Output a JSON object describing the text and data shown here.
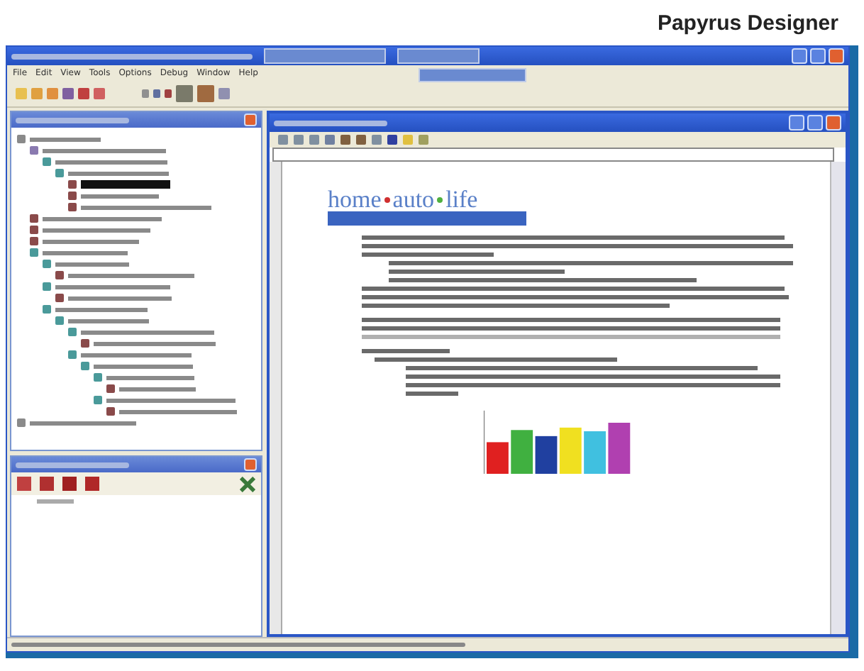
{
  "header": {
    "title": "Papyrus Designer"
  },
  "menu": [
    "File",
    "Edit",
    "View",
    "Tools",
    "Options",
    "Debug",
    "Window",
    "Help"
  ],
  "tree": [
    {
      "kind": "folder",
      "selected": false,
      "children": [
        {
          "kind": "group",
          "selected": false,
          "children": [
            {
              "kind": "node",
              "selected": false,
              "children": [
                {
                  "kind": "node",
                  "selected": false,
                  "children": [
                    {
                      "kind": "doc",
                      "selected": true
                    },
                    {
                      "kind": "doc",
                      "selected": false
                    },
                    {
                      "kind": "doc",
                      "selected": false
                    }
                  ]
                }
              ]
            }
          ]
        },
        {
          "kind": "doc",
          "selected": false
        },
        {
          "kind": "doc",
          "selected": false
        },
        {
          "kind": "doc",
          "selected": false
        },
        {
          "kind": "node",
          "selected": false,
          "children": [
            {
              "kind": "node",
              "selected": false,
              "children": [
                {
                  "kind": "doc",
                  "selected": false
                }
              ]
            },
            {
              "kind": "node",
              "selected": false,
              "children": [
                {
                  "kind": "doc",
                  "selected": false
                }
              ]
            },
            {
              "kind": "node",
              "selected": false,
              "children": [
                {
                  "kind": "node",
                  "selected": false,
                  "children": [
                    {
                      "kind": "node",
                      "selected": false,
                      "children": [
                        {
                          "kind": "doc",
                          "selected": false
                        }
                      ]
                    },
                    {
                      "kind": "node",
                      "selected": false,
                      "children": [
                        {
                          "kind": "node",
                          "selected": false,
                          "children": [
                            {
                              "kind": "node",
                              "selected": false,
                              "children": [
                                {
                                  "kind": "doc",
                                  "selected": false
                                }
                              ]
                            },
                            {
                              "kind": "node",
                              "selected": false,
                              "children": [
                                {
                                  "kind": "doc",
                                  "selected": false
                                }
                              ]
                            }
                          ]
                        }
                      ]
                    }
                  ]
                }
              ]
            }
          ]
        }
      ]
    },
    {
      "kind": "folder",
      "selected": false
    }
  ],
  "logo": {
    "words": [
      "home",
      "auto",
      "life"
    ]
  }
}
